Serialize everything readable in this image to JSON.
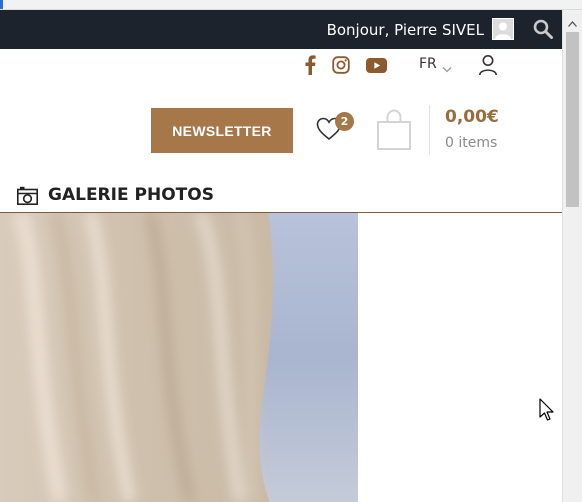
{
  "header": {
    "greeting": "Bonjour, Pierre SIVEL"
  },
  "icons": {
    "avatar": "avatar-icon",
    "search": "search-icon",
    "facebook": "facebook-icon",
    "instagram": "instagram-icon",
    "youtube": "youtube-icon",
    "user": "user-icon",
    "heart": "heart-icon",
    "cart": "shopping-bag-icon",
    "camera": "camera-icon"
  },
  "lang": {
    "current": "FR"
  },
  "actions": {
    "newsletter_label": "NEWSLETTER",
    "wishlist_count": "2"
  },
  "cart": {
    "total": "0,00€",
    "items_label": "0 items"
  },
  "gallery": {
    "title": "GALERIE PHOTOS"
  },
  "colors": {
    "topbar": "#1d232c",
    "accent": "#a67749",
    "price": "#9b6b3d"
  }
}
